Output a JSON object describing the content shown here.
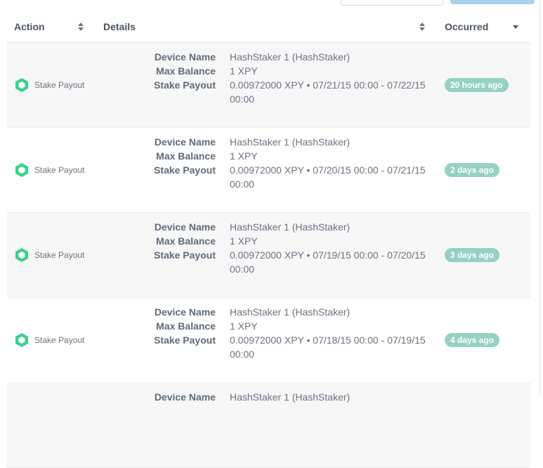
{
  "header": {
    "action": "Action",
    "details": "Details",
    "occurred": "Occurred"
  },
  "colors": {
    "accent": "#3ecf8e",
    "badge": "#95d1c4",
    "row_alt": "#f7f7f8"
  },
  "icons": {
    "action": "hexagon-icon",
    "sort": "sort-icon",
    "sort_desc": "sort-desc-icon"
  },
  "detail_labels": {
    "device_name": "Device Name",
    "max_balance": "Max Balance",
    "stake_payout": "Stake Payout"
  },
  "rows": [
    {
      "action": "Stake Payout",
      "device_name": "HashStaker 1 (HashStaker)",
      "max_balance": "1 XPY",
      "stake_payout": "0.00972000 XPY • 07/21/15 00:00 - 07/22/15 00:00",
      "occurred": "20 hours ago"
    },
    {
      "action": "Stake Payout",
      "device_name": "HashStaker 1 (HashStaker)",
      "max_balance": "1 XPY",
      "stake_payout": "0.00972000 XPY • 07/20/15 00:00 - 07/21/15 00:00",
      "occurred": "2 days ago"
    },
    {
      "action": "Stake Payout",
      "device_name": "HashStaker 1 (HashStaker)",
      "max_balance": "1 XPY",
      "stake_payout": "0.00972000 XPY • 07/19/15 00:00 - 07/20/15 00:00",
      "occurred": "3 days ago"
    },
    {
      "action": "Stake Payout",
      "device_name": "HashStaker 1 (HashStaker)",
      "max_balance": "1 XPY",
      "stake_payout": "0.00972000 XPY • 07/18/15 00:00 - 07/19/15 00:00",
      "occurred": "4 days ago"
    },
    {
      "action": "",
      "device_name": "HashStaker 1 (HashStaker)",
      "max_balance": "",
      "stake_payout": "",
      "occurred": ""
    }
  ]
}
